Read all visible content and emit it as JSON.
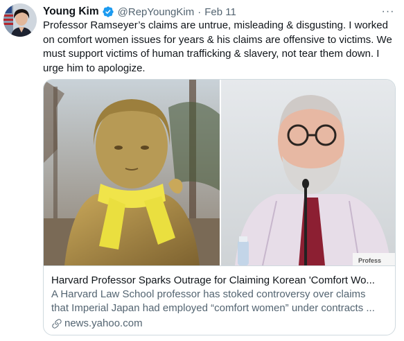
{
  "tweet": {
    "author_name": "Young Kim",
    "handle": "@RepYoungKim",
    "separator": "·",
    "date": "Feb 11",
    "more_label": "···",
    "text": "Professor Ramseyer’s claims are untrue, misleading & disgusting. I worked on comfort women issues for years & his claims are offensive to victims. We must support victims of human trafficking & slavery, not tear them down. I urge him to apologize."
  },
  "card": {
    "title": "Harvard Professor Sparks Outrage for Claiming Korean 'Comfort Wo...",
    "description_line1": "A Harvard Law School professor has stoked controversy over claims",
    "description_line2": "that Imperial Japan had employed “comfort women” under contracts ...",
    "domain": "news.yahoo.com",
    "photo_right_nameplate": "Profess"
  },
  "icons": {
    "verified": "verified-badge-icon",
    "more": "more-horizontal-icon",
    "link": "link-icon"
  },
  "colors": {
    "text_primary": "#0f1419",
    "text_secondary": "#536471",
    "verified_blue": "#1d9bf0",
    "border": "#cfd9de"
  }
}
